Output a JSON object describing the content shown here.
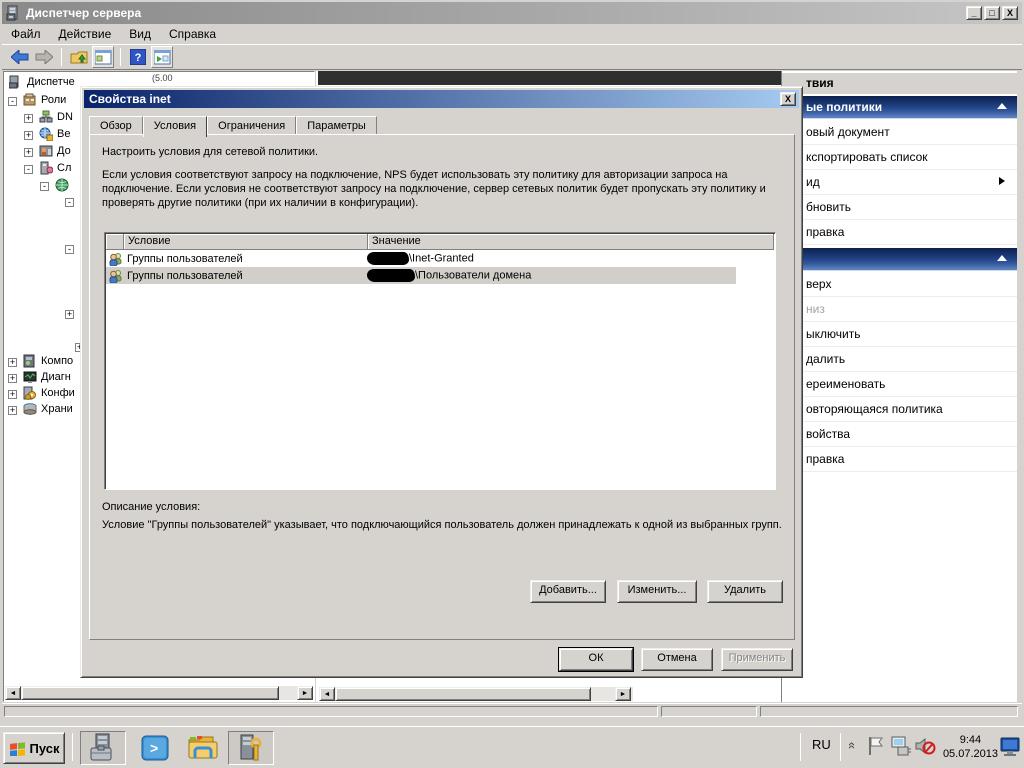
{
  "window": {
    "title": "Диспетчер сервера"
  },
  "menu": {
    "items": [
      "Файл",
      "Действие",
      "Вид",
      "Справка"
    ]
  },
  "tree": {
    "items": [
      {
        "label": "Диспетче"
      },
      {
        "label": "Роли"
      },
      {
        "label": "DN"
      },
      {
        "label": "Ве"
      },
      {
        "label": "До"
      },
      {
        "label": "Сл"
      },
      {
        "label": "Компо"
      },
      {
        "label": "Диагн"
      },
      {
        "label": "Конфи"
      },
      {
        "label": "Храни"
      }
    ]
  },
  "center": {
    "fragment": "(5.00"
  },
  "dialog": {
    "title": "Свойства inet",
    "tabs": [
      "Обзор",
      "Условия",
      "Ограничения",
      "Параметры"
    ],
    "intro": "Настроить условия для сетевой политики.",
    "paragraph": "Если условия соответствуют запросу на подключение, NPS будет использовать эту политику для авторизации запроса на подключение. Если условия не соответствуют запросу на подключение, сервер сетевых политик будет пропускать эту политику и проверять другие политики (при их наличии в конфигурации).",
    "columns": {
      "condition": "Условие",
      "value": "Значение"
    },
    "rows": [
      {
        "condition": "Группы пользователей",
        "value": "\\Inet-Granted"
      },
      {
        "condition": "Группы пользователей",
        "value": "\\Пользователи домена"
      }
    ],
    "desc_label": "Описание условия:",
    "desc_text": "Условие \"Группы пользователей\" указывает, что подключающийся пользователь должен принадлежать к одной из выбранных групп.",
    "add": "Добавить...",
    "edit": "Изменить...",
    "delete": "Удалить",
    "ok": "ОК",
    "cancel": "Отмена",
    "apply": "Применить"
  },
  "actions": {
    "title": "твия",
    "section1": {
      "header": "ые политики",
      "items": [
        "овый документ",
        "кспортировать список",
        "ид",
        "бновить",
        "правка"
      ]
    },
    "section2": {
      "items": [
        "верх",
        "низ",
        "ыключить",
        "далить",
        "ереименовать",
        "овторяющаяся политика",
        "войства",
        "правка"
      ]
    }
  },
  "taskbar": {
    "start": "Пуск",
    "lang": "RU",
    "time": "9:44",
    "date": "05.07.2013"
  }
}
